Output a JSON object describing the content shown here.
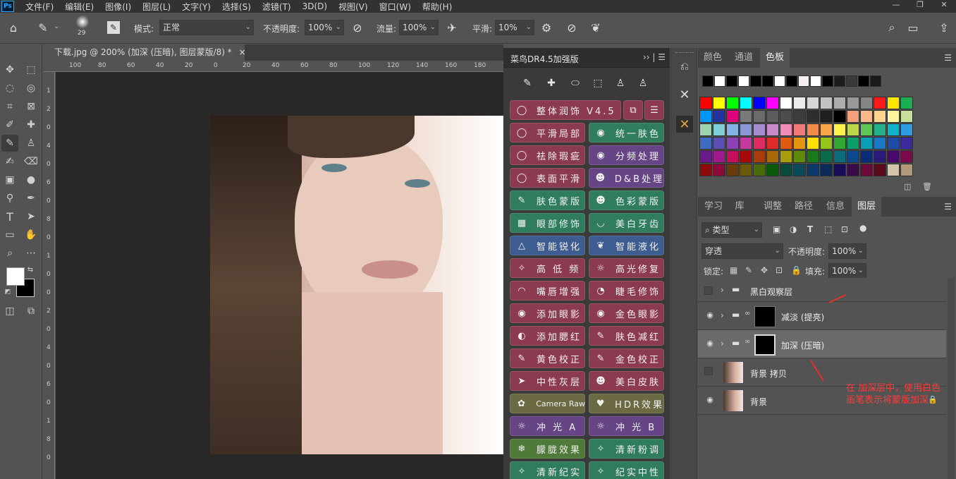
{
  "menubar": {
    "logo": "Ps",
    "items": [
      "文件(F)",
      "编辑(E)",
      "图像(I)",
      "图层(L)",
      "文字(Y)",
      "选择(S)",
      "滤镜(T)",
      "3D(D)",
      "视图(V)",
      "窗口(W)",
      "帮助(H)"
    ],
    "win": [
      "—",
      "❐",
      "✕"
    ]
  },
  "options": {
    "brush_size": "29",
    "mode_label": "模式:",
    "mode_value": "正常",
    "opacity_label": "不透明度:",
    "opacity_value": "100%",
    "flow_label": "流量:",
    "flow_value": "100%",
    "smooth_label": "平滑:",
    "smooth_value": "10%"
  },
  "document": {
    "tab_title": "下载.jpg @ 200% (加深 (压暗), 图层蒙版/8) *",
    "close": "×",
    "ruler_h": [
      "100",
      "80",
      "60",
      "40",
      "20",
      "0",
      "20",
      "40",
      "60",
      "80",
      "100",
      "120",
      "140",
      "160",
      "180",
      "200",
      "220",
      "240",
      "260"
    ],
    "ruler_v": [
      "1",
      "2",
      "0",
      "4",
      "0",
      "6",
      "0",
      "8",
      "0",
      "1",
      "0",
      "0",
      "2",
      "0",
      "4",
      "0",
      "6",
      "0",
      "1",
      "8",
      "0"
    ]
  },
  "plugin": {
    "title": "菜鸟DR4.5加强版",
    "controls": "›› | ☰",
    "top_button": "整体润饰 V4.5",
    "buttons": [
      {
        "label": "平滑局部",
        "icon": "◯"
      },
      {
        "label": "统一肤色",
        "icon": "◉"
      },
      {
        "label": "祛除瑕疵",
        "icon": "◯"
      },
      {
        "label": "分频处理",
        "icon": "◉"
      },
      {
        "label": "表面平滑",
        "icon": "◯"
      },
      {
        "label": "D&B处理",
        "icon": "☻"
      },
      {
        "label": "肤色蒙版",
        "icon": "✎"
      },
      {
        "label": "色彩蒙版",
        "icon": "☻"
      },
      {
        "label": "眼部修饰",
        "icon": "▦"
      },
      {
        "label": "美白牙齿",
        "icon": "◡"
      },
      {
        "label": "智能锐化",
        "icon": "△"
      },
      {
        "label": "智能液化",
        "icon": "❦"
      },
      {
        "label": "高 低 频",
        "icon": "✧"
      },
      {
        "label": "高光修复",
        "icon": "☼"
      },
      {
        "label": "嘴唇增强",
        "icon": "◠"
      },
      {
        "label": "睫毛修饰",
        "icon": "◔"
      },
      {
        "label": "添加眼影",
        "icon": "◉"
      },
      {
        "label": "金色眼影",
        "icon": "◉"
      },
      {
        "label": "添加腮红",
        "icon": "◐"
      },
      {
        "label": "肤色减红",
        "icon": "✎"
      },
      {
        "label": "黄色校正",
        "icon": "✎"
      },
      {
        "label": "金色校正",
        "icon": "✎"
      },
      {
        "label": "中性灰层",
        "icon": "➤"
      },
      {
        "label": "美白皮肤",
        "icon": "☻"
      },
      {
        "label": "Camera Raw",
        "icon": "✿"
      },
      {
        "label": "HDR效果",
        "icon": "♥"
      },
      {
        "label": "冲 光 A",
        "icon": "☼"
      },
      {
        "label": "冲 光 B",
        "icon": "☼"
      },
      {
        "label": "朦胧效果",
        "icon": "❄"
      },
      {
        "label": "清新粉调",
        "icon": "✧"
      },
      {
        "label": "清新纪实",
        "icon": "✧"
      },
      {
        "label": "纪实中性",
        "icon": "✧"
      }
    ]
  },
  "swatch_panel": {
    "tabs": [
      "颜色",
      "通道",
      "色板"
    ]
  },
  "layers_panel": {
    "tabs": [
      "学习",
      "库",
      "调整",
      "路径",
      "信息",
      "图层"
    ],
    "filter_label": "类型",
    "blend": "穿透",
    "opacity_label": "不透明度:",
    "opacity_value": "100%",
    "lock_label": "锁定:",
    "fill_label": "填充:",
    "fill_value": "100%",
    "layers": [
      "黑白观察层",
      "减淡 (提亮)",
      "加深 (压暗)",
      "背景 拷贝",
      "背景"
    ]
  },
  "annotation": "在 加深层中，使用白色画笔表示将蒙版加深",
  "colors": {
    "accent": "#e83030"
  }
}
